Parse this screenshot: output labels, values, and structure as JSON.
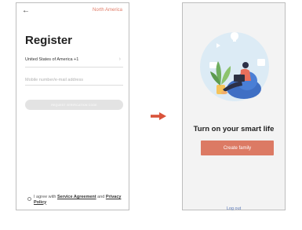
{
  "register_screen": {
    "region_label": "North America",
    "title": "Register",
    "country_code_value": "United States of America +1",
    "account_placeholder": "Mobile number/e-mail address",
    "verify_button_label": "REQUEST VERIFICATION CODE",
    "agreement_prefix": "I agree with",
    "service_agreement_label": "Service Agreement",
    "agreement_and": "and",
    "privacy_policy_label": "Privacy Policy"
  },
  "home_screen": {
    "tagline": "Turn on your smart life",
    "create_family_label": "Create family",
    "logout_label": "Log out"
  },
  "colors": {
    "accent": "#dc7a64",
    "link_blue": "#5a79b8",
    "illustration_bg": "#dcebf5"
  },
  "icons": {
    "back": "back-arrow-icon",
    "country_chevron": "chevron-right-icon",
    "flow": "right-arrow-icon"
  }
}
